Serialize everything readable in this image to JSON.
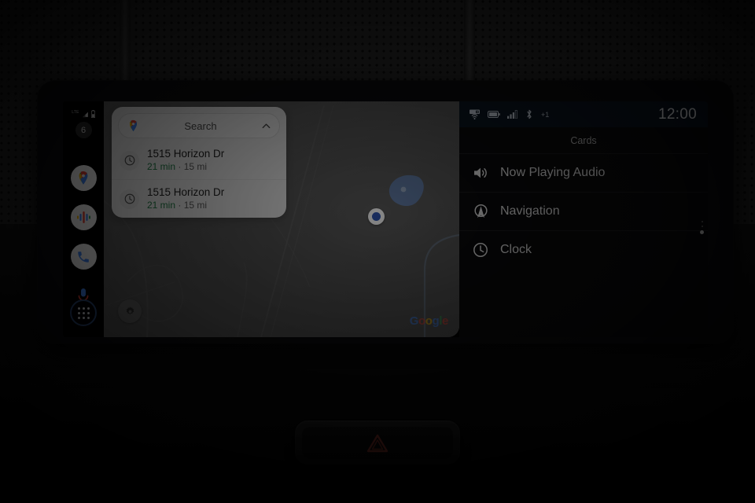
{
  "device": {
    "type": "car-infotainment-head-unit",
    "os": "android-auto"
  },
  "rail": {
    "status": {
      "network_label": "LTE",
      "signal_icon": "signal-bars-icon",
      "battery_icon": "battery-icon"
    },
    "badge": "6",
    "items": [
      {
        "name": "maps",
        "icon": "google-maps-icon"
      },
      {
        "name": "assistant",
        "icon": "google-assistant-icon"
      },
      {
        "name": "phone",
        "icon": "phone-icon"
      },
      {
        "name": "microphone",
        "icon": "microphone-icon"
      }
    ],
    "launcher": {
      "name": "app-launcher",
      "icon": "apps-grid-icon"
    }
  },
  "map": {
    "search": {
      "placeholder": "Search",
      "leading_icon": "google-maps-pin-icon",
      "trailing_icon": "chevron-up-icon"
    },
    "suggestions": [
      {
        "icon": "recent-clock-icon",
        "title": "1515 Horizon Dr",
        "eta": "21 min",
        "separator": " · ",
        "distance": "15 mi"
      },
      {
        "icon": "recent-clock-icon",
        "title": "1515 Horizon Dr",
        "eta": "21 min",
        "separator": " · ",
        "distance": "15 mi"
      }
    ],
    "settings_button": {
      "icon": "gear-icon"
    },
    "location_dot": {
      "icon": "current-location-dot"
    },
    "attribution": {
      "parts": [
        "G",
        "o",
        "o",
        "g",
        "l",
        "e"
      ],
      "text": "Google"
    },
    "colors": {
      "surface": "#575757",
      "water": "#5e7aa8",
      "road": "#6a6a6a",
      "location_blue": "#2c4fa3"
    }
  },
  "right_panel": {
    "status_bar": {
      "icons": [
        "hotspot-cast-icon",
        "battery-icon",
        "signal-bars-icon",
        "bluetooth-icon"
      ],
      "extra_count": "+1",
      "time": "12:00"
    },
    "header": "Cards",
    "cards": [
      {
        "icon": "volume-icon",
        "label": "Now Playing Audio"
      },
      {
        "icon": "navigation-arrow-icon",
        "label": "Navigation"
      },
      {
        "icon": "clock-icon",
        "label": "Clock"
      }
    ],
    "scroll_indicator": {
      "dots": 2,
      "active_index": 2
    }
  },
  "dashboard": {
    "hazard_button": {
      "icon": "hazard-triangle-icon",
      "color": "#7a2f26"
    }
  }
}
